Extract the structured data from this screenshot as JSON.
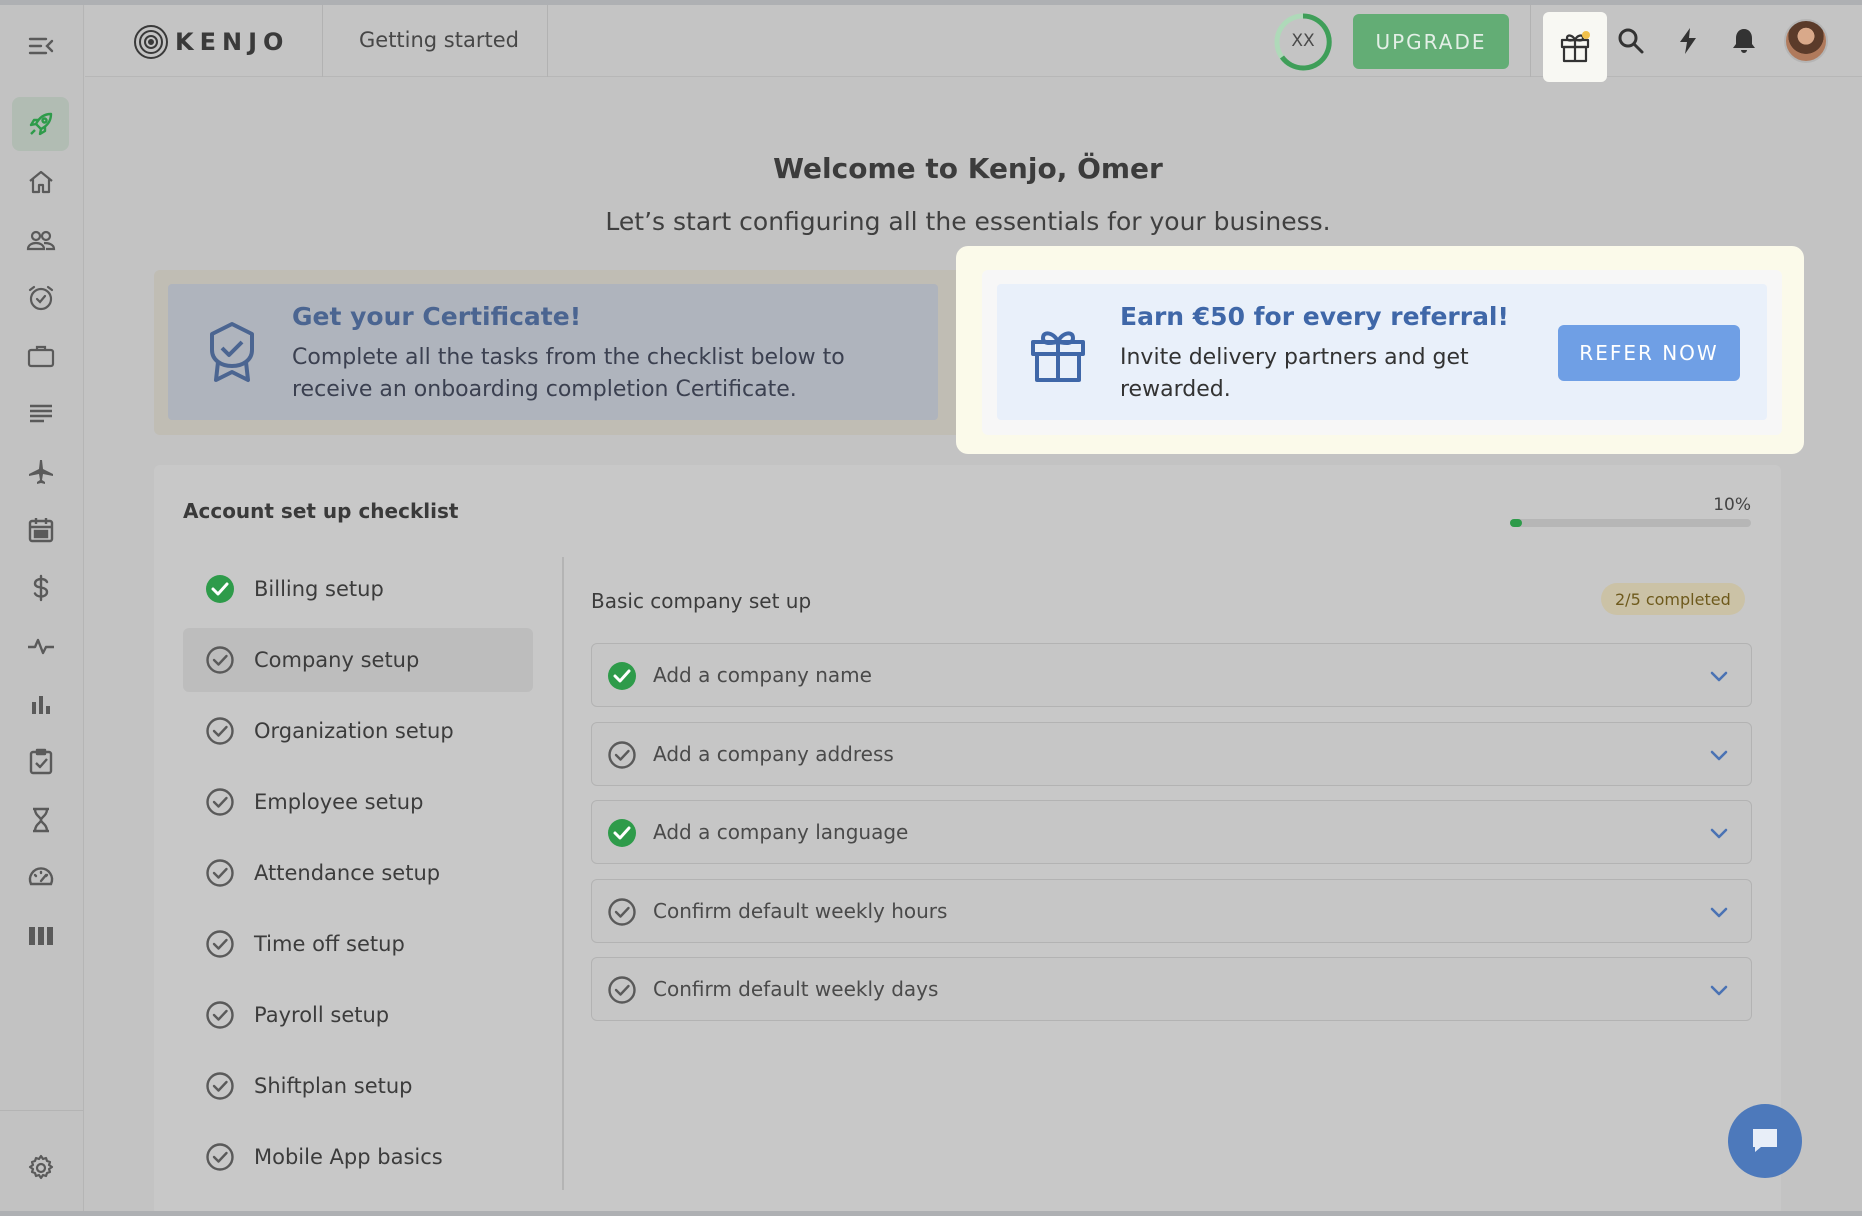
{
  "app": {
    "logo_text": "KENJO",
    "page_title": "Getting started",
    "trial_badge": "XX",
    "upgrade_label": "UPGRADE"
  },
  "sidebar": {
    "items": [
      {
        "name": "collapse-menu-icon"
      },
      {
        "name": "rocket-icon",
        "active": true
      },
      {
        "name": "home-icon"
      },
      {
        "name": "people-icon"
      },
      {
        "name": "alarm-clock-icon"
      },
      {
        "name": "briefcase-icon"
      },
      {
        "name": "list-icon"
      },
      {
        "name": "airplane-icon"
      },
      {
        "name": "calendar-icon"
      },
      {
        "name": "dollar-icon"
      },
      {
        "name": "pulse-icon"
      },
      {
        "name": "bar-chart-icon"
      },
      {
        "name": "checklist-icon"
      },
      {
        "name": "hourglass-icon"
      },
      {
        "name": "speedometer-icon"
      },
      {
        "name": "columns-icon"
      },
      {
        "name": "gear-icon"
      }
    ]
  },
  "welcome": {
    "title": "Welcome to Kenjo, Ömer",
    "subtitle": "Let’s start configuring all the essentials for your business."
  },
  "certificate": {
    "title": "Get your Certificate!",
    "text": "Complete all the tasks from the checklist below to receive an onboarding completion Certificate."
  },
  "referral": {
    "title": "Earn €50 for every referral!",
    "text": "Invite delivery partners and get rewarded.",
    "button": "REFER NOW"
  },
  "checklist": {
    "title": "Account set up checklist",
    "progress_label": "10%",
    "progress": 0.1,
    "steps": [
      {
        "label": "Billing setup",
        "done": true
      },
      {
        "label": "Company setup",
        "done": false,
        "selected": true
      },
      {
        "label": "Organization setup",
        "done": false
      },
      {
        "label": "Employee setup",
        "done": false
      },
      {
        "label": "Attendance setup",
        "done": false
      },
      {
        "label": "Time off setup",
        "done": false
      },
      {
        "label": "Payroll setup",
        "done": false
      },
      {
        "label": "Shiftplan setup",
        "done": false
      },
      {
        "label": "Mobile App basics",
        "done": false
      }
    ],
    "section": {
      "title": "Basic company set up",
      "badge": "2/5 completed",
      "tasks": [
        {
          "label": "Add a company name",
          "done": true
        },
        {
          "label": "Add a company address",
          "done": false
        },
        {
          "label": "Add a company language",
          "done": true
        },
        {
          "label": "Confirm default weekly hours",
          "done": false
        },
        {
          "label": "Confirm default weekly days",
          "done": false
        }
      ]
    }
  },
  "colors": {
    "accent_green": "#2e9b4a",
    "upgrade_green": "#63ad75",
    "refer_blue": "#6f9fe5",
    "chat_blue": "#4d79bb"
  }
}
